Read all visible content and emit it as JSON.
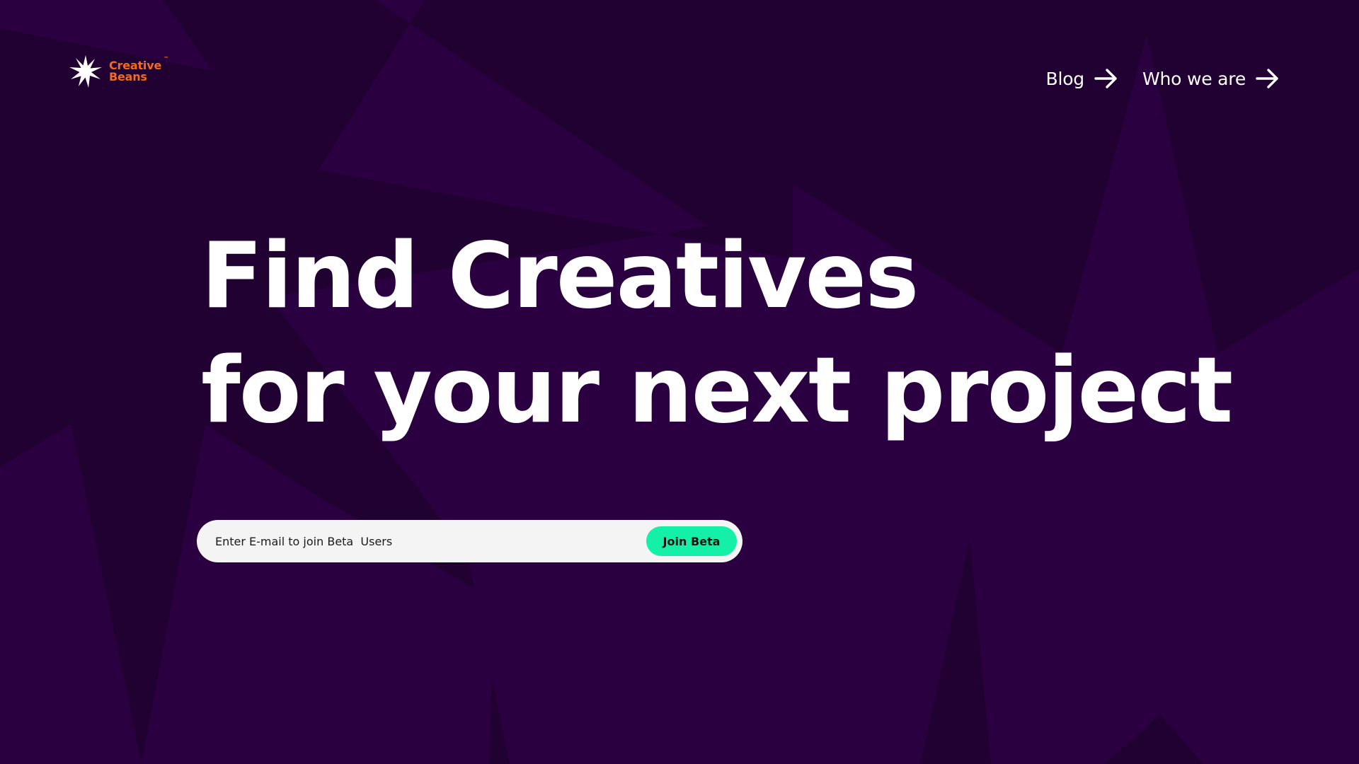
{
  "brand": {
    "name_line1": "Creative",
    "name_line2": "Beans",
    "trademark": "™",
    "color": "#f26b1d"
  },
  "nav": {
    "items": [
      {
        "label": "Blog",
        "icon": "arrow-right-icon"
      },
      {
        "label": "Who we are",
        "icon": "arrow-right-icon"
      }
    ]
  },
  "hero": {
    "line1": "Find Creatives",
    "line2": "for your next project"
  },
  "signup": {
    "placeholder": "Enter E-mail to join Beta  Users",
    "button_label": "Join Beta",
    "button_color": "#14f0a8"
  },
  "theme": {
    "background": "#210032",
    "shape_color": "#2b0040"
  }
}
